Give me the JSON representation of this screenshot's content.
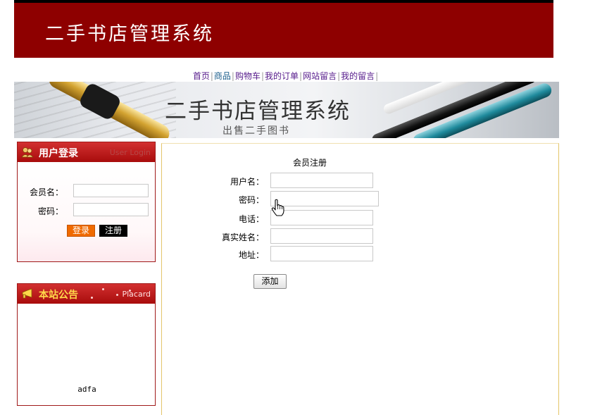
{
  "header": {
    "site_title": "二手书店管理系统"
  },
  "nav": {
    "items": [
      "首页",
      "商品",
      "购物车",
      "我的订单",
      "网站留言",
      "我的留言"
    ]
  },
  "hero": {
    "title": "二手书店管理系统",
    "subtitle": "出售二手图书"
  },
  "login_panel": {
    "title": "用户登录",
    "title_en": "User Login",
    "member_label": "会员名：",
    "password_label": "密码：",
    "login_button": "登录",
    "register_button": "注册"
  },
  "notice_panel": {
    "title": "本站公告",
    "title_en": "Placard",
    "content": "adfa"
  },
  "register_form": {
    "title": "会员注册",
    "fields": [
      {
        "label": "用户名："
      },
      {
        "label": "密码："
      },
      {
        "label": "电话："
      },
      {
        "label": "真实姓名："
      },
      {
        "label": "地址："
      }
    ],
    "submit_label": "添加"
  },
  "colors": {
    "banner": "#8e0000",
    "panel_header": "#a80c0c",
    "login_button": "#f06a00",
    "notice_title": "#ffd84a"
  }
}
